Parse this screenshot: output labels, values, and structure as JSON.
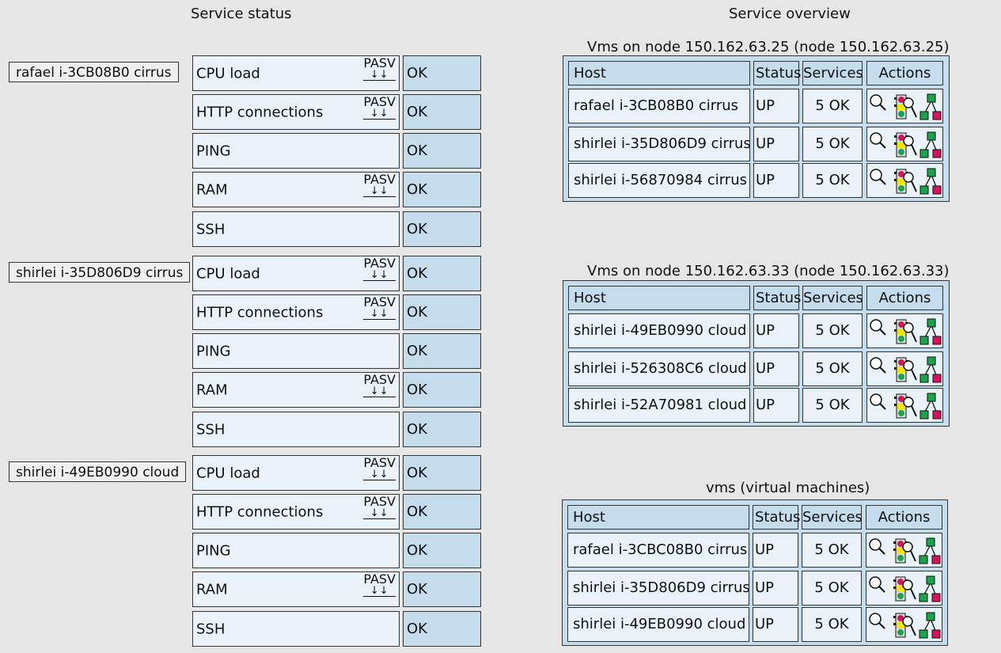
{
  "headings": {
    "service_status": "Service status",
    "service_overview": "Service overview"
  },
  "service_groups": [
    {
      "host": "rafael i-3CB08B0 cirrus",
      "services": [
        {
          "name": "CPU load",
          "passive": "PASV",
          "passive_arrows": "↓↓",
          "state": "OK"
        },
        {
          "name": "HTTP connections",
          "passive": "PASV",
          "passive_arrows": "↓↓",
          "state": "OK"
        },
        {
          "name": "PING",
          "state": "OK"
        },
        {
          "name": "RAM",
          "passive": "PASV",
          "passive_arrows": "↓↓",
          "state": "OK"
        },
        {
          "name": "SSH",
          "state": "OK"
        }
      ]
    },
    {
      "host": "shirlei i-35D806D9 cirrus",
      "services": [
        {
          "name": "CPU load",
          "passive": "PASV",
          "passive_arrows": "↓↓",
          "state": "OK"
        },
        {
          "name": "HTTP connections",
          "passive": "PASV",
          "passive_arrows": "↓↓",
          "state": "OK"
        },
        {
          "name": "PING",
          "state": "OK"
        },
        {
          "name": "RAM",
          "passive": "PASV",
          "passive_arrows": "↓↓",
          "state": "OK"
        },
        {
          "name": "SSH",
          "state": "OK"
        }
      ]
    },
    {
      "host": "shirlei i-49EB0990 cloud",
      "services": [
        {
          "name": "CPU load",
          "passive": "PASV",
          "passive_arrows": "↓↓",
          "state": "OK"
        },
        {
          "name": "HTTP connections",
          "passive": "PASV",
          "passive_arrows": "↓↓",
          "state": "OK"
        },
        {
          "name": "PING",
          "state": "OK"
        },
        {
          "name": "RAM",
          "passive": "PASV",
          "passive_arrows": "↓↓",
          "state": "OK"
        },
        {
          "name": "SSH",
          "state": "OK"
        }
      ]
    }
  ],
  "overview_columns": {
    "host": "Host",
    "status": "Status",
    "services": "Services",
    "actions": "Actions"
  },
  "overview_panels": [
    {
      "title": "Vms on node 150.162.63.25 (node 150.162.63.25)",
      "rows": [
        {
          "host": "rafael i-3CB08B0 cirrus",
          "status": "UP",
          "services": "5 OK"
        },
        {
          "host": "shirlei i-35D806D9 cirrus",
          "status": "UP",
          "services": "5 OK"
        },
        {
          "host": "shirlei i-56870984 cirrus",
          "status": "UP",
          "services": "5 OK"
        }
      ]
    },
    {
      "title": "Vms on node 150.162.63.33 (node 150.162.63.33)",
      "rows": [
        {
          "host": "shirlei i-49EB0990 cloud",
          "status": "UP",
          "services": "5 OK"
        },
        {
          "host": "shirlei i-526308C6 cloud",
          "status": "UP",
          "services": "5 OK"
        },
        {
          "host": "shirlei i-52A70981 cloud",
          "status": "UP",
          "services": "5 OK"
        }
      ]
    },
    {
      "title": "vms (virtual machines)",
      "rows": [
        {
          "host": "rafael i-3CBC08B0 cirrus",
          "status": "UP",
          "services": "5 OK"
        },
        {
          "host": "shirlei i-35D806D9 cirrus",
          "status": "UP",
          "services": "5 OK"
        },
        {
          "host": "shirlei i-49EB0990 cloud",
          "status": "UP",
          "services": "5 OK"
        }
      ]
    }
  ],
  "action_icons": [
    "magnifier-icon",
    "traffic-light-icon",
    "network-map-icon"
  ],
  "colors": {
    "panel": "#c4dcec",
    "cell": "#e8f2f8",
    "background": "#e6e6e6",
    "green": "#1aa34a",
    "magenta": "#d4145a",
    "yellow": "#f4e400"
  }
}
